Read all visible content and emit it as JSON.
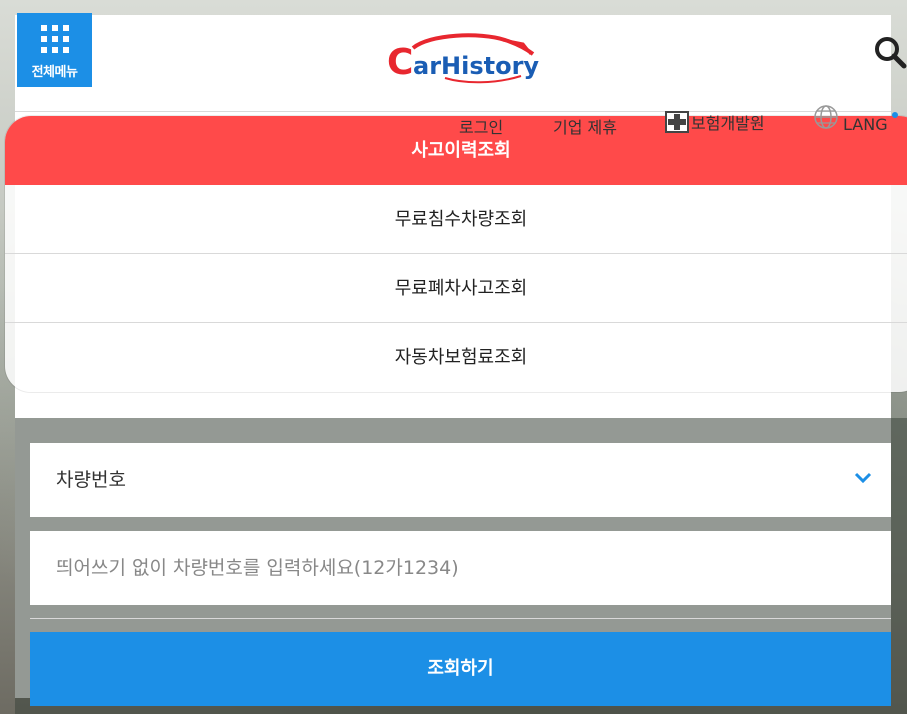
{
  "header": {
    "menu_label": "전체메뉴",
    "logo_text": "CarHistory"
  },
  "utility": {
    "login": "로그인",
    "corporate": "기업 제휴",
    "insurance_institute": "보험개발원",
    "lang": "LANG"
  },
  "overlay_menu": {
    "items": [
      {
        "label": "사고이력조회",
        "active": true
      },
      {
        "label": "무료침수차량조회",
        "active": false
      },
      {
        "label": "무료폐차사고조회",
        "active": false
      },
      {
        "label": "자동차보험료조회",
        "active": false
      }
    ]
  },
  "form": {
    "select_value": "차량번호",
    "input_placeholder": "띄어쓰기 없이 차량번호를 입력하세요(12가1234)",
    "input_value": "",
    "submit_label": "조회하기"
  },
  "colors": {
    "accent": "#1c8fe6",
    "active_red": "#ff4a4a",
    "logo_red": "#e8272f",
    "logo_blue": "#1a5db4"
  },
  "icons": [
    "grid-menu-icon",
    "search-icon",
    "insurance-cross-icon",
    "globe-icon",
    "chevron-down-icon"
  ]
}
